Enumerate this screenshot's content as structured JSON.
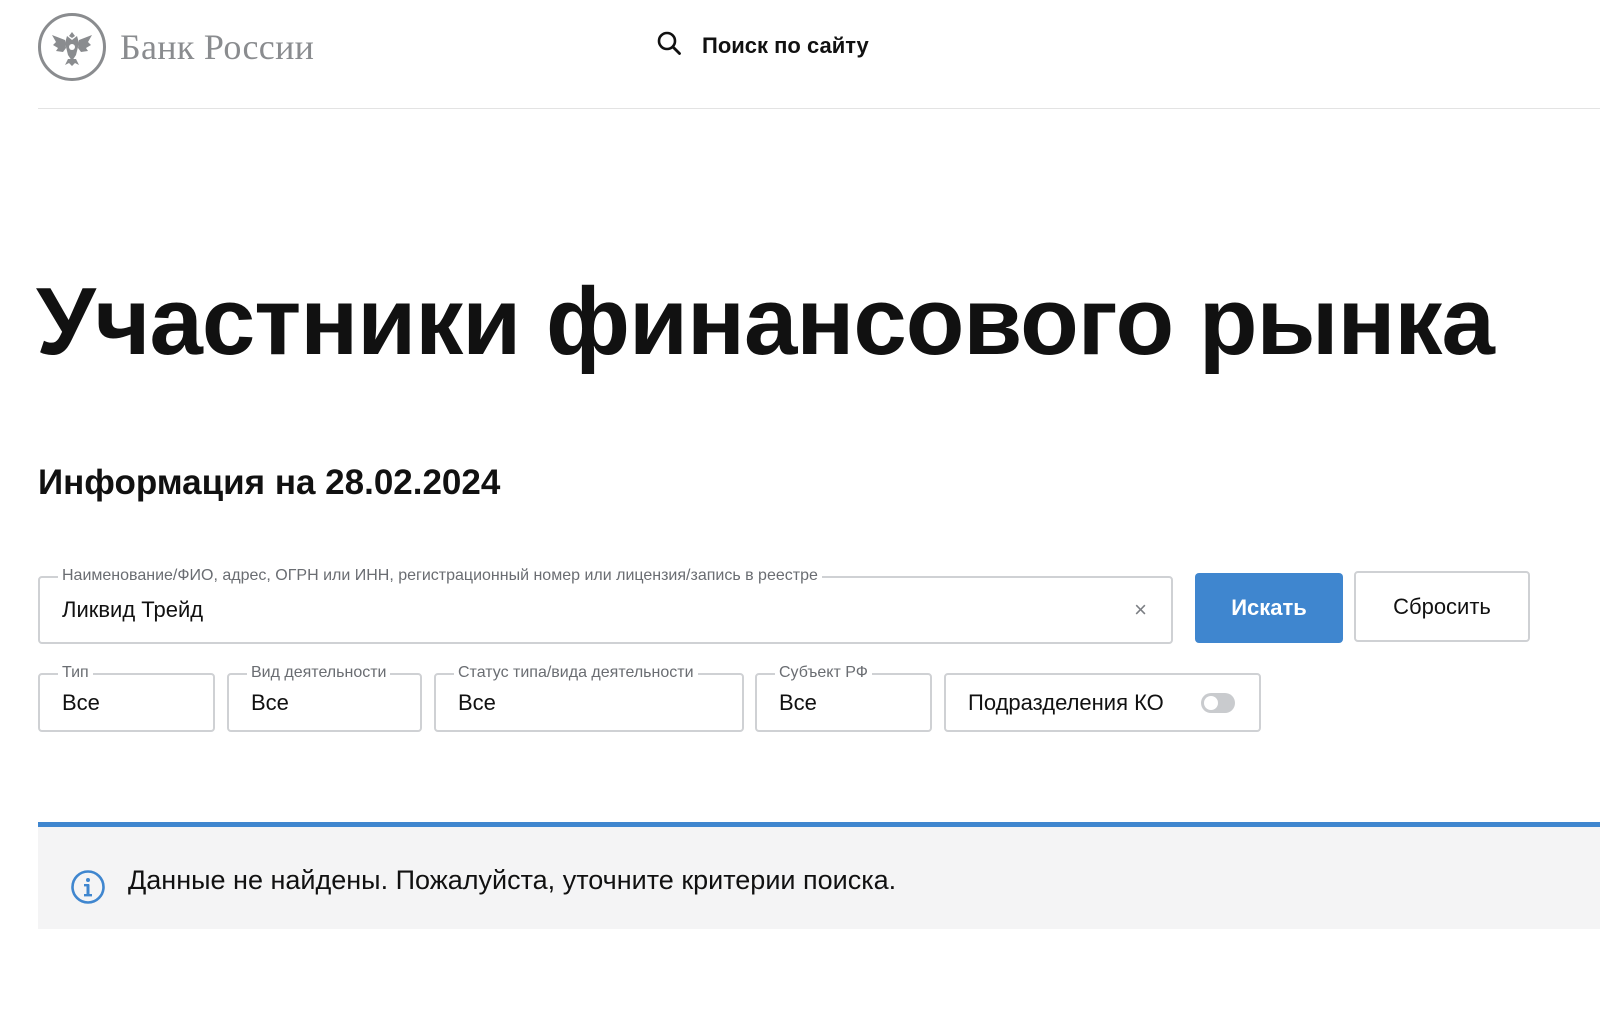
{
  "header": {
    "logo_text": "Банк России",
    "search_label": "Поиск по сайту"
  },
  "page": {
    "title": "Участники финансового рынка",
    "info_date": "Информация на 28.02.2024"
  },
  "search": {
    "legend": "Наименование/ФИО, адрес, ОГРН или ИНН, регистрационный номер или лицензия/запись в реестре",
    "value": "Ликвид Трейд",
    "clear_glyph": "×",
    "search_button": "Искать",
    "reset_button": "Сбросить"
  },
  "filters": {
    "type": {
      "legend": "Тип",
      "value": "Все"
    },
    "activity": {
      "legend": "Вид деятельности",
      "value": "Все"
    },
    "status": {
      "legend": "Статус типа/вида деятельности",
      "value": "Все"
    },
    "region": {
      "legend": "Субъект РФ",
      "value": "Все"
    },
    "branches": {
      "label": "Подразделения КО",
      "enabled": false
    }
  },
  "notice": {
    "text": "Данные не найдены. Пожалуйста, уточните критерии поиска."
  },
  "icons": {
    "logo": "bank-emblem-icon",
    "search": "search-icon",
    "clear": "close-icon",
    "info": "info-icon"
  },
  "colors": {
    "accent": "#3f86cf",
    "logo_gray": "#8a8c8f",
    "border": "#cfd1d4",
    "notice_bg": "#f4f4f5"
  }
}
